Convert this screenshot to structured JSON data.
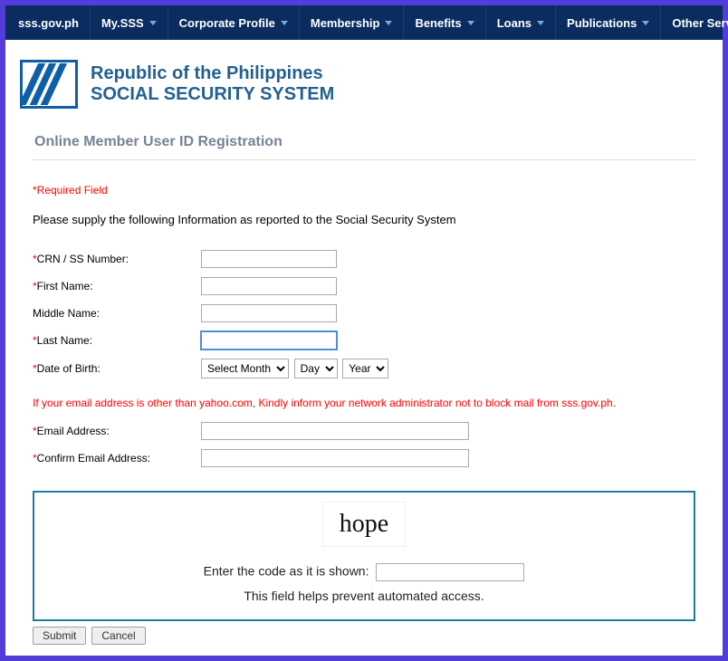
{
  "nav": {
    "items": [
      {
        "label": "sss.gov.ph",
        "has_dropdown": false
      },
      {
        "label": "My.SSS",
        "has_dropdown": true
      },
      {
        "label": "Corporate Profile",
        "has_dropdown": true
      },
      {
        "label": "Membership",
        "has_dropdown": true
      },
      {
        "label": "Benefits",
        "has_dropdown": true
      },
      {
        "label": "Loans",
        "has_dropdown": true
      },
      {
        "label": "Publications",
        "has_dropdown": true
      },
      {
        "label": "Other Services",
        "has_dropdown": true
      }
    ]
  },
  "header": {
    "line1": "Republic of the Philippines",
    "line2": "SOCIAL SECURITY SYSTEM"
  },
  "section_title": "Online Member User ID Registration",
  "required_note": "*Required Field",
  "instruction": "Please supply the following Information as reported to the Social Security System",
  "fields": {
    "crn": {
      "label": "CRN / SS Number:",
      "required": true,
      "value": ""
    },
    "first_name": {
      "label": "First Name:",
      "required": true,
      "value": ""
    },
    "middle_name": {
      "label": "Middle Name:",
      "required": false,
      "value": ""
    },
    "last_name": {
      "label": "Last Name:",
      "required": true,
      "value": ""
    },
    "dob": {
      "label": "Date of Birth:",
      "required": true,
      "month": "Select Month",
      "day": "Day",
      "year": "Year"
    },
    "email": {
      "label": "Email Address:",
      "required": true,
      "value": ""
    },
    "confirm_email": {
      "label": "Confirm Email Address:",
      "required": true,
      "value": ""
    }
  },
  "email_note": "If your email address is other than yahoo.com, Kindly inform your network administrator not to block mail from sss.gov.ph.",
  "captcha": {
    "image_text": "hope",
    "prompt": "Enter the code as it is shown:",
    "help": "This field helps prevent automated access."
  },
  "actions": {
    "submit": "Submit",
    "cancel": "Cancel"
  }
}
